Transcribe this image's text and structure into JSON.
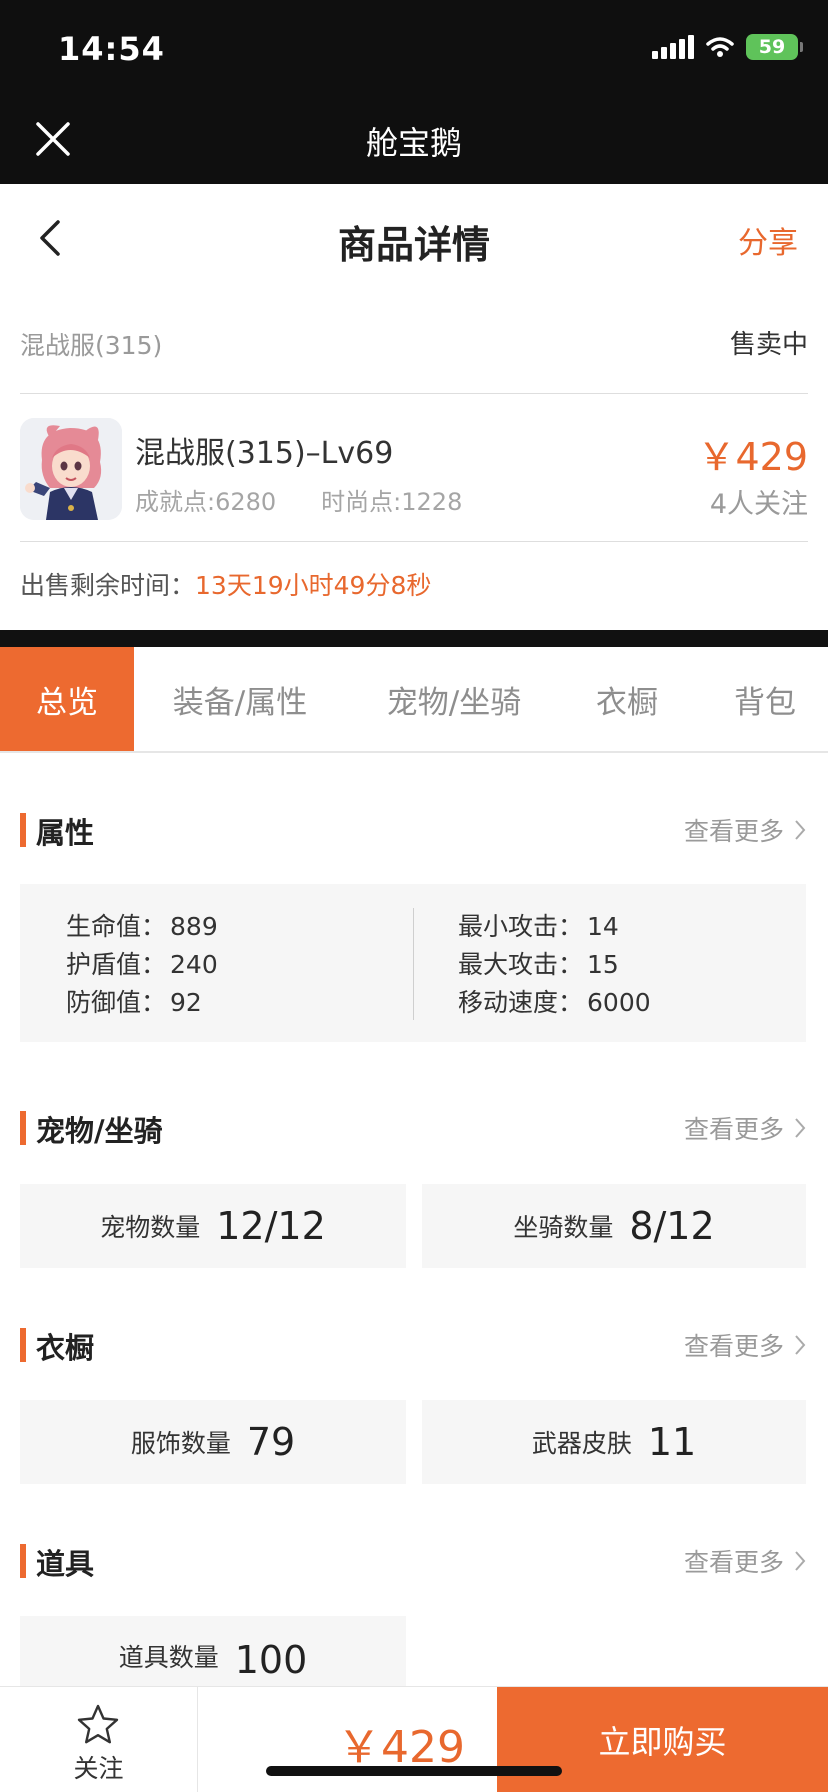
{
  "status_bar": {
    "time": "14:54",
    "battery": "59"
  },
  "app_bar": {
    "title": "舱宝鹅"
  },
  "nav": {
    "title": "商品详情",
    "share": "分享"
  },
  "product": {
    "server": "混战服(315)",
    "status": "售卖中",
    "name": "混战服(315)–Lv69",
    "achievement": "成就点:6280",
    "fashion": "时尚点:1228",
    "price": "￥429",
    "followers": "4人关注",
    "timer_label": "出售剩余时间：",
    "timer_value": "13天19小时49分8秒"
  },
  "tabs": [
    "总览",
    "装备/属性",
    "宠物/坐骑",
    "衣橱",
    "背包"
  ],
  "more_label": "查看更多",
  "attributes": {
    "title": "属性",
    "left": [
      {
        "label": "生命值：",
        "value": "889"
      },
      {
        "label": "护盾值：",
        "value": "240"
      },
      {
        "label": "防御值：",
        "value": "92"
      }
    ],
    "right": [
      {
        "label": "最小攻击：",
        "value": "14"
      },
      {
        "label": "最大攻击：",
        "value": "15"
      },
      {
        "label": "移动速度：",
        "value": "6000"
      }
    ]
  },
  "pets": {
    "title": "宠物/坐骑",
    "cards": [
      {
        "label": "宠物数量",
        "value": "12/12"
      },
      {
        "label": "坐骑数量",
        "value": "8/12"
      }
    ]
  },
  "wardrobe": {
    "title": "衣橱",
    "cards": [
      {
        "label": "服饰数量",
        "value": "79"
      },
      {
        "label": "武器皮肤",
        "value": "11"
      }
    ]
  },
  "items": {
    "title": "道具",
    "cards": [
      {
        "label": "道具数量",
        "value": "100"
      }
    ]
  },
  "bottom": {
    "follow": "关注",
    "price": "￥429",
    "buy": "立即购买"
  },
  "colors": {
    "accent": "#ed6a30",
    "bar_bg": "#0f0f0f",
    "card_bg": "#f6f6f6"
  },
  "icons": [
    "close-icon",
    "back-icon",
    "chevron-right-icon",
    "star-icon",
    "signal-icon",
    "wifi-icon",
    "battery-icon"
  ]
}
